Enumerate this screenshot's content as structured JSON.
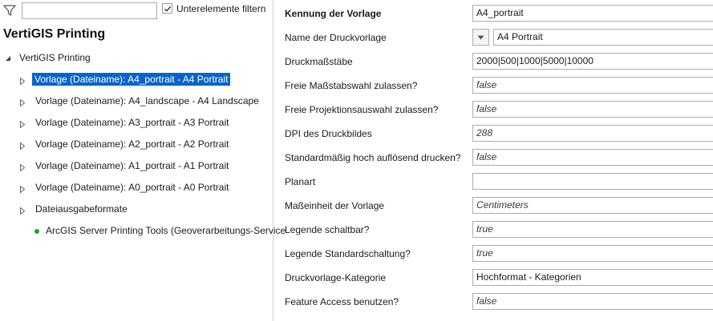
{
  "toolbar": {
    "search_value": "",
    "filter_checkbox_checked": true,
    "filter_checkbox_label": "Unterelemente filtern"
  },
  "app": {
    "title": "VertiGIS Printing"
  },
  "tree": {
    "root_label": "VertiGIS Printing",
    "items": [
      {
        "label": "Vorlage (Dateiname): A4_portrait - A4 Portrait",
        "selected": true
      },
      {
        "label": "Vorlage (Dateiname): A4_landscape - A4 Landscape"
      },
      {
        "label": "Vorlage (Dateiname): A3_portrait - A3 Portrait"
      },
      {
        "label": "Vorlage (Dateiname): A2_portrait - A2 Portrait"
      },
      {
        "label": "Vorlage (Dateiname): A1_portrait - A1 Portrait"
      },
      {
        "label": "Vorlage (Dateiname): A0_portrait - A0 Portrait"
      },
      {
        "label": "Dateiausgabeformate"
      }
    ],
    "leaf_label": "ArcGIS Server Printing Tools (Geoverarbeitungs-Service",
    "leaf_status_color": "#17a829"
  },
  "properties": [
    {
      "label": "Kennung der Vorlage",
      "value": "A4_portrait"
    },
    {
      "label": "Name der Druckvorlage",
      "value": "A4 Portrait"
    },
    {
      "label": "Druckmaßstäbe",
      "value": "2000|500|1000|5000|10000"
    },
    {
      "label": "Freie Maßstabswahl zulassen?",
      "value": "false"
    },
    {
      "label": "Freie Projektionsauswahl zulassen?",
      "value": "false"
    },
    {
      "label": "DPI des Druckbildes",
      "value": "288"
    },
    {
      "label": "Standardmäßig hoch auflösend drucken?",
      "value": "false"
    },
    {
      "label": "Planart",
      "value": ""
    },
    {
      "label": "Maßeinheit der Vorlage",
      "value": "Centimeters"
    },
    {
      "label": "Legende schaltbar?",
      "value": "true"
    },
    {
      "label": "Legende Standardschaltung?",
      "value": "true"
    },
    {
      "label": "Druckvorlage-Kategorie",
      "value": "Hochformat - Kategorien"
    },
    {
      "label": "Feature Access benutzen?",
      "value": "false"
    }
  ],
  "colors": {
    "selection": "#0a64c8",
    "border": "#acacac"
  }
}
